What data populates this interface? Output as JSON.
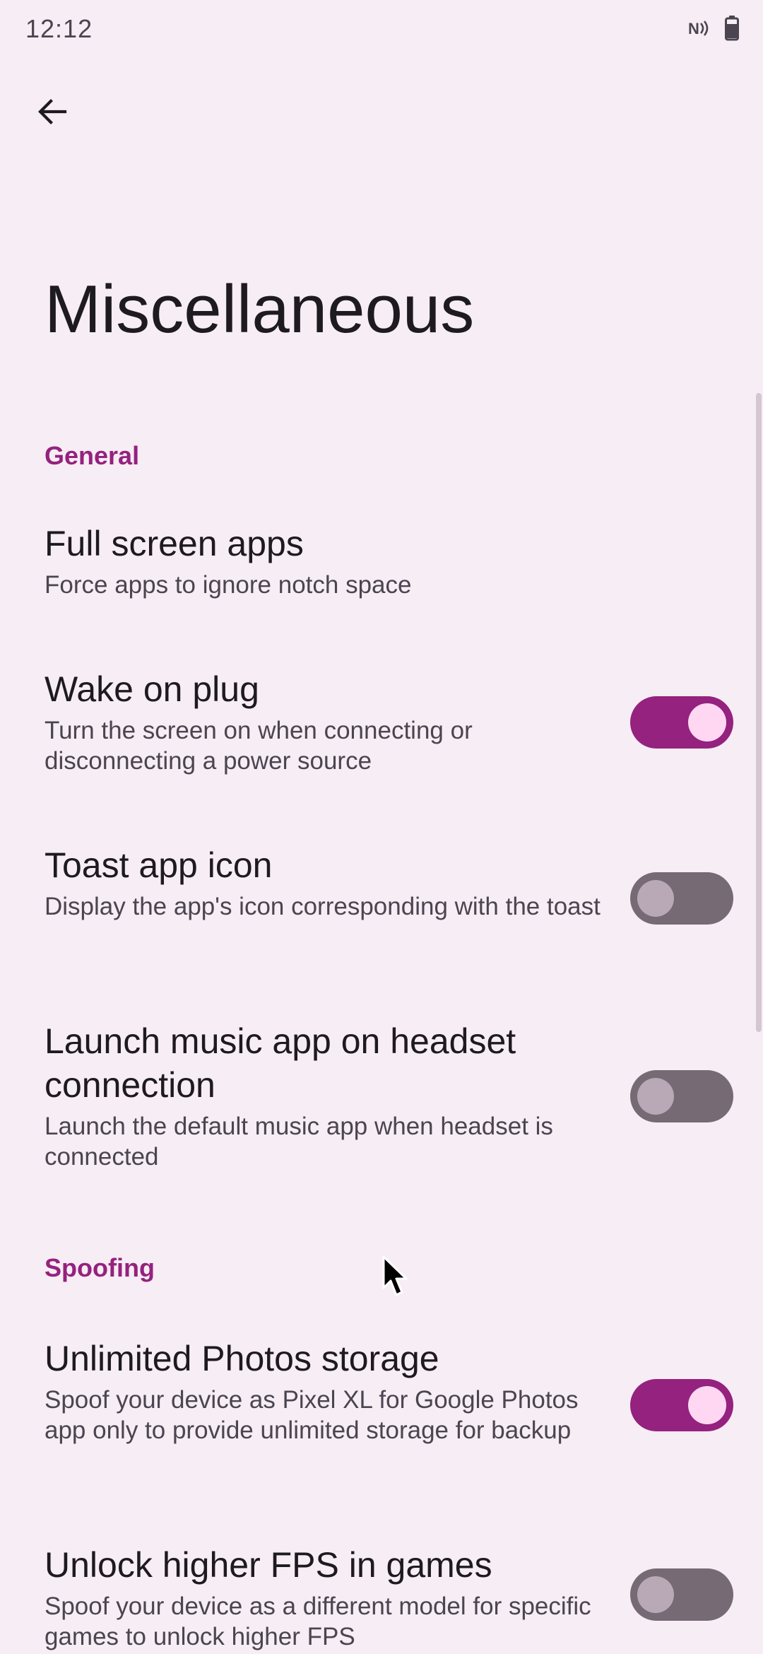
{
  "status_bar": {
    "time": "12:12",
    "icons": [
      "nfc-icon",
      "battery-icon"
    ]
  },
  "header": {
    "back_icon": "arrow-back-icon",
    "title": "Miscellaneous"
  },
  "sections": {
    "general": {
      "header": "General",
      "items": [
        {
          "title": "Full screen apps",
          "summary": "Force apps to ignore notch space"
        },
        {
          "title": "Wake on plug",
          "summary": "Turn the screen on when connecting or disconnecting a power source",
          "toggle": "on"
        },
        {
          "title": "Toast app icon",
          "summary": "Display the app's icon corresponding with the toast",
          "toggle": "off"
        },
        {
          "title": "Launch music app on headset connection",
          "summary": "Launch the default music app when headset is connected",
          "toggle": "off"
        }
      ]
    },
    "spoofing": {
      "header": "Spoofing",
      "items": [
        {
          "title": "Unlimited Photos storage",
          "summary": "Spoof your device as Pixel XL for Google Photos app only to provide unlimited storage for backup",
          "toggle": "on"
        },
        {
          "title": "Unlock higher FPS in games",
          "summary": "Spoof your device as a different model for specific games to unlock higher FPS",
          "toggle": "off"
        }
      ]
    }
  },
  "colors": {
    "background": "#F7EDF4",
    "accent": "#94227E",
    "toggle_on_thumb": "#FFD7F2",
    "toggle_off_track": "#766A75",
    "toggle_off_thumb": "#B9A9B6",
    "secondary_text": "#4A4550"
  }
}
